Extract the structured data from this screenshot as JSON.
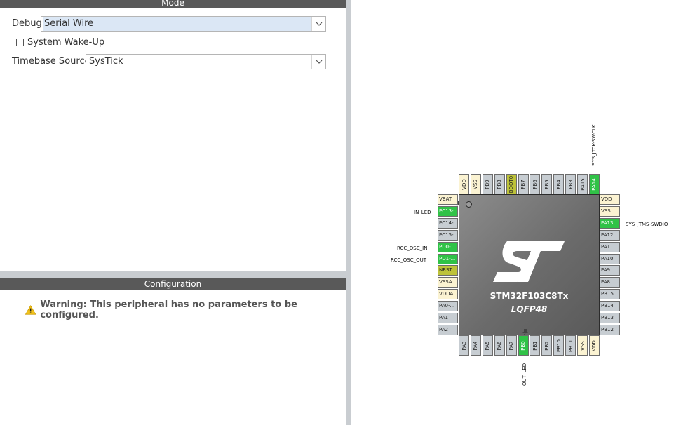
{
  "mode": {
    "header": "Mode",
    "debug_label": "Debug",
    "debug_value": "Serial Wire",
    "wakeup_label": "System Wake-Up",
    "wakeup_checked": false,
    "timebase_label": "Timebase Source",
    "timebase_value": "SysTick"
  },
  "configuration": {
    "header": "Configuration",
    "warning": "Warning: This peripheral has no parameters to be configured."
  },
  "chip": {
    "name": "STM32F103C8Tx",
    "package": "LQFP48",
    "pins_top": [
      {
        "label": "VDD",
        "type": "power"
      },
      {
        "label": "VSS",
        "type": "power"
      },
      {
        "label": "PB9",
        "type": "gray"
      },
      {
        "label": "PB8",
        "type": "gray"
      },
      {
        "label": "BOOT0",
        "type": "olive"
      },
      {
        "label": "PB7",
        "type": "gray"
      },
      {
        "label": "PB6",
        "type": "gray"
      },
      {
        "label": "PB5",
        "type": "gray"
      },
      {
        "label": "PB4",
        "type": "gray"
      },
      {
        "label": "PB3",
        "type": "gray"
      },
      {
        "label": "PA15",
        "type": "gray"
      },
      {
        "label": "PA14",
        "type": "green"
      }
    ],
    "pins_left": [
      {
        "label": "VBAT",
        "type": "power"
      },
      {
        "label": "PC13-...",
        "type": "green"
      },
      {
        "label": "PC14-...",
        "type": "gray"
      },
      {
        "label": "PC15-...",
        "type": "gray"
      },
      {
        "label": "PD0-...",
        "type": "green"
      },
      {
        "label": "PD1-...",
        "type": "green"
      },
      {
        "label": "NRST",
        "type": "olive"
      },
      {
        "label": "VSSA",
        "type": "power"
      },
      {
        "label": "VDDA",
        "type": "power"
      },
      {
        "label": "PA0-...",
        "type": "gray"
      },
      {
        "label": "PA1",
        "type": "gray"
      },
      {
        "label": "PA2",
        "type": "gray"
      }
    ],
    "pins_right": [
      {
        "label": "VDD",
        "type": "power"
      },
      {
        "label": "VSS",
        "type": "power"
      },
      {
        "label": "PA13",
        "type": "green"
      },
      {
        "label": "PA12",
        "type": "gray"
      },
      {
        "label": "PA11",
        "type": "gray"
      },
      {
        "label": "PA10",
        "type": "gray"
      },
      {
        "label": "PA9",
        "type": "gray"
      },
      {
        "label": "PA8",
        "type": "gray"
      },
      {
        "label": "PB15",
        "type": "gray"
      },
      {
        "label": "PB14",
        "type": "gray"
      },
      {
        "label": "PB13",
        "type": "gray"
      },
      {
        "label": "PB12",
        "type": "gray"
      }
    ],
    "pins_bottom": [
      {
        "label": "PA3",
        "type": "gray"
      },
      {
        "label": "PA4",
        "type": "gray"
      },
      {
        "label": "PA5",
        "type": "gray"
      },
      {
        "label": "PA6",
        "type": "gray"
      },
      {
        "label": "PA7",
        "type": "gray"
      },
      {
        "label": "PB0",
        "type": "green"
      },
      {
        "label": "PB1",
        "type": "gray"
      },
      {
        "label": "PB2",
        "type": "gray"
      },
      {
        "label": "PB10",
        "type": "gray"
      },
      {
        "label": "PB11",
        "type": "gray"
      },
      {
        "label": "VSS",
        "type": "power"
      },
      {
        "label": "VDD",
        "type": "power"
      }
    ],
    "signals": {
      "in_led": "IN_LED",
      "rcc_osc_in": "RCC_OSC_IN",
      "rcc_osc_out": "RCC_OSC_OUT",
      "out_led": "OUT_LED",
      "swclk": "SYS_JTCK-SWCLK",
      "swdio": "SYS_JTMS-SWDIO"
    }
  },
  "colors": {
    "header_bg": "#595959",
    "pin_green": "#30c247",
    "pin_gray": "#c7cdd2",
    "pin_power": "#fbf3d2",
    "pin_olive": "#bdc239",
    "warning_yellow": "#f2c21b"
  }
}
